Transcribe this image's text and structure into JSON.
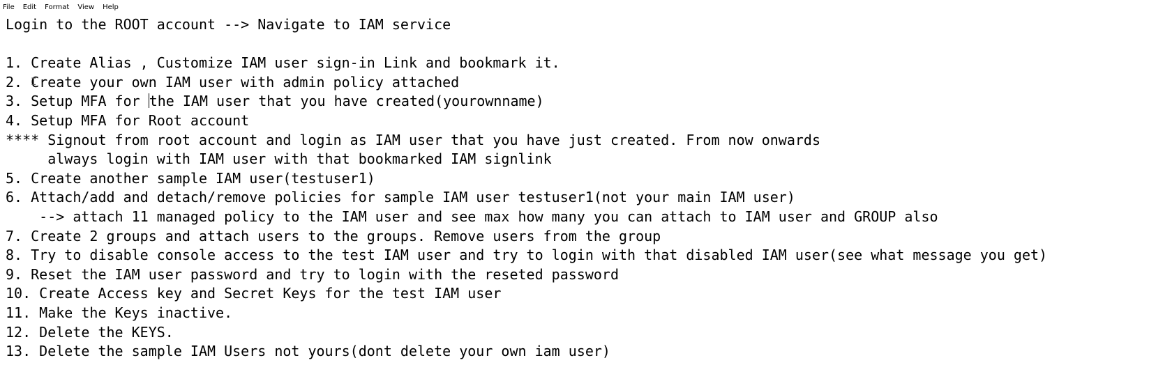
{
  "menu": {
    "items": [
      "File",
      "Edit",
      "Format",
      "View",
      "Help"
    ]
  },
  "editor": {
    "lines": [
      "Login to the ROOT account --> Navigate to IAM service",
      "",
      "1. Create Alias , Customize IAM user sign-in Link and bookmark it.",
      "2. Create your own IAM user with admin policy attached",
      "3. Setup MFA for the IAM user that you have created(yourownname)",
      "4. Setup MFA for Root account",
      "**** Signout from root account and login as IAM user that you have just created. From now onwards",
      "     always login with IAM user with that bookmarked IAM signlink",
      "5. Create another sample IAM user(testuser1)",
      "6. Attach/add and detach/remove policies for sample IAM user testuser1(not your main IAM user)",
      "    --> attach 11 managed policy to the IAM user and see max how many you can attach to IAM user and GROUP also",
      "7. Create 2 groups and attach users to the groups. Remove users from the group",
      "8. Try to disable console access to the test IAM user and try to login with that disabled IAM user(see what message you get)",
      "9. Reset the IAM user password and try to login with the reseted password",
      "10. Create Access key and Secret Keys for the test IAM user",
      "11. Make the Keys inactive.",
      "12. Delete the KEYS.",
      "13. Delete the sample IAM Users not yours(dont delete your own iam user)"
    ],
    "caret_line_index": 4,
    "caret_column": 17
  }
}
